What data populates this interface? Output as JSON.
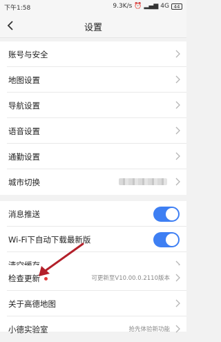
{
  "status_bar": {
    "time": "下午1:58",
    "network_speed": "9.3K/s",
    "network_type": "4G",
    "battery": "44"
  },
  "header": {
    "title": "设置"
  },
  "group1": [
    {
      "label": "账号与安全"
    },
    {
      "label": "地图设置"
    },
    {
      "label": "导航设置"
    },
    {
      "label": "语音设置"
    },
    {
      "label": "通勤设置"
    },
    {
      "label": "城市切换",
      "value_blurred": true
    }
  ],
  "group2": [
    {
      "label": "消息推送",
      "toggle_on": true
    },
    {
      "label": "Wi-Fi下自动下载最新版",
      "toggle_on": true
    },
    {
      "label": "清空缓存"
    }
  ],
  "group3": [
    {
      "label": "检查更新",
      "value": "可更新至V10.00.0.2110版本",
      "badge": "red-dot"
    },
    {
      "label": "关于高德地图"
    },
    {
      "label": "小德实验室",
      "value": "抢先体验新功能"
    }
  ],
  "colors": {
    "toggle_on": "#3e7ff3",
    "badge": "#e23b3b",
    "annotation_arrow": "#b3202a"
  }
}
